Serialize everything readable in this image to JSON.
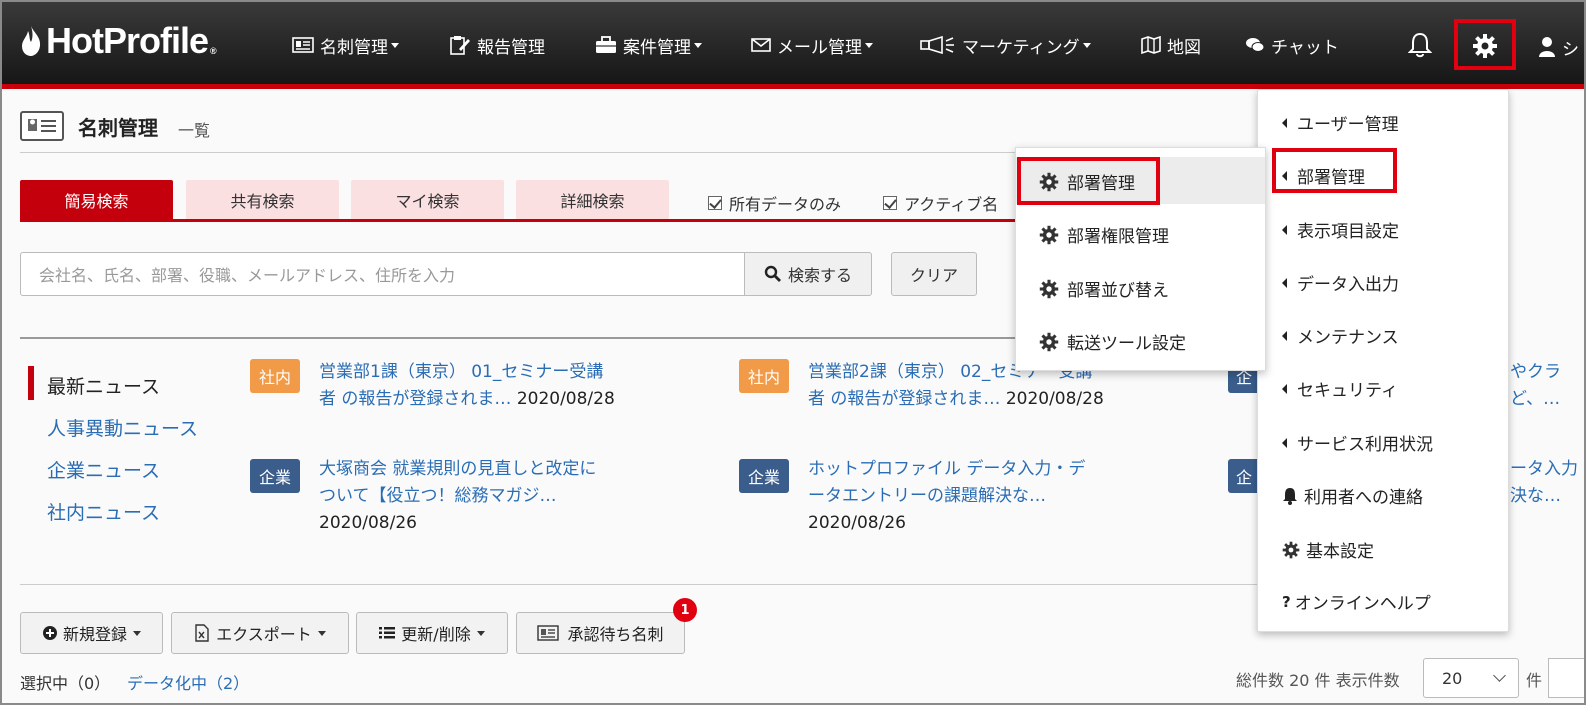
{
  "header": {
    "logo": "HotProfile",
    "logo_mark": "®",
    "nav": [
      {
        "label": "名刺管理",
        "icon": "card-icon",
        "dropdown": true
      },
      {
        "label": "報告管理",
        "icon": "report-icon",
        "dropdown": false
      },
      {
        "label": "案件管理",
        "icon": "briefcase-icon",
        "dropdown": true
      },
      {
        "label": "メール管理",
        "icon": "mail-icon",
        "dropdown": true
      },
      {
        "label": "マーケティング",
        "icon": "megaphone-icon",
        "dropdown": true
      },
      {
        "label": "地図",
        "icon": "map-icon",
        "dropdown": false
      },
      {
        "label": "チャット",
        "icon": "chat-icon",
        "dropdown": false
      }
    ],
    "user_label": "シ"
  },
  "page": {
    "title": "名刺管理",
    "subtitle": "一覧"
  },
  "search": {
    "tabs": [
      "簡易検索",
      "共有検索",
      "マイ検索",
      "詳細検索"
    ],
    "active_tab": 0,
    "checkboxes": [
      "所有データのみ",
      "アクティブ名"
    ],
    "placeholder": "会社名、氏名、部署、役職、メールアドレス、住所を入力",
    "search_button": "検索する",
    "clear_button": "クリア"
  },
  "news": {
    "categories": [
      "最新ニュース",
      "人事異動ニュース",
      "企業ニュース",
      "社内ニュース"
    ],
    "items": [
      {
        "badge": "社内",
        "title": "営業部1課（東京） 01_セミナー受講者 の報告が登録されま…",
        "title_l1": "営業部1課（東京） 01_セミナー受講",
        "title_l2": "者 の報告が登録されま…",
        "date": "2020/08/28"
      },
      {
        "badge": "社内",
        "title": "営業部2課（東京） 02_セミナー受講者 の報告が登録されま…",
        "title_l1": "営業部2課（東京） 02_セミナー受講",
        "title_l2": "者 の報告が登録されま…",
        "date": "2020/08/28"
      },
      {
        "badge": "企業",
        "title": "大塚商会 就業規則の見直しと改定について【役立つ！総務マガジ…",
        "title_l1": "大塚商会 就業規則の見直しと改定に",
        "title_l2": "ついて【役立つ！総務マガジ…",
        "date": "2020/08/26"
      },
      {
        "badge": "企業",
        "title": "ホットプロファイル データ入力・データエントリーの課題解決な…",
        "title_l1": "ホットプロファイル データ入力・デ",
        "title_l2": "ータエントリーの課題解決な…",
        "date": "2020/08/26"
      }
    ],
    "clipped": [
      {
        "badge": "企",
        "l1": "やクラ",
        "l2": "ど、…"
      },
      {
        "badge": "企",
        "l1": "ータ入力",
        "l2": "決な…"
      }
    ]
  },
  "toolbar": {
    "new": "新規登録",
    "export": "エクスポート",
    "update": "更新/削除",
    "pending": "承認待ち名刺",
    "pending_count": "1"
  },
  "footer": {
    "selected": "選択中（0）",
    "digitizing": "データ化中（2）",
    "count_text": "総件数 20 件 表示件数",
    "per_page": "20",
    "unit": "件"
  },
  "settings_menu": {
    "items": [
      {
        "label": "ユーザー管理",
        "icon": "triangle-left-icon"
      },
      {
        "label": "部署管理",
        "icon": "triangle-left-icon"
      },
      {
        "label": "表示項目設定",
        "icon": "triangle-left-icon"
      },
      {
        "label": "データ入出力",
        "icon": "triangle-left-icon"
      },
      {
        "label": "メンテナンス",
        "icon": "triangle-left-icon"
      },
      {
        "label": "セキュリティ",
        "icon": "triangle-left-icon"
      },
      {
        "label": "サービス利用状況",
        "icon": "triangle-left-icon"
      },
      {
        "label": "利用者への連絡",
        "icon": "bell-icon"
      },
      {
        "label": "基本設定",
        "icon": "gear-icon"
      },
      {
        "label": "オンラインヘルプ",
        "icon": "question-icon"
      }
    ]
  },
  "dept_submenu": {
    "items": [
      "部署管理",
      "部署権限管理",
      "部署並び替え",
      "転送ツール設定"
    ]
  },
  "colors": {
    "accent": "#c4000c",
    "highlight": "#e00010",
    "link": "#2a6db5",
    "badge_internal": "#f19a47",
    "badge_company": "#3a5d8c"
  }
}
